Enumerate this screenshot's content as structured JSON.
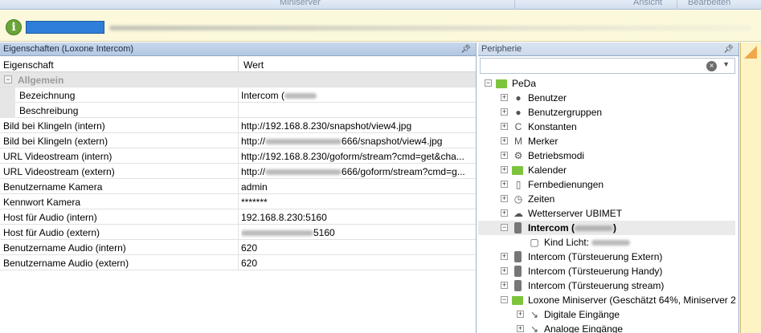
{
  "ribbon": {
    "center_label": "Miniserver",
    "right_labels": [
      "Ansicht",
      "Bearbeiten"
    ]
  },
  "infobar": {
    "icon": "info-icon"
  },
  "properties_panel": {
    "title": "Eigenschaften (Loxone Intercom)",
    "columns": {
      "property": "Eigenschaft",
      "value": "Wert"
    },
    "group_label": "Allgemein",
    "rows": [
      {
        "name": "Bezeichnung",
        "value": "Intercom (",
        "sub": true
      },
      {
        "name": "Beschreibung",
        "value": "",
        "sub": true
      },
      {
        "name": "Bild bei Klingeln (intern)",
        "value": "http://192.168.8.230/snapshot/view4.jpg"
      },
      {
        "name": "Bild bei Klingeln (extern)",
        "value_prefix": "http://",
        "value": "666/snapshot/view4.jpg"
      },
      {
        "name": "URL Videostream (intern)",
        "value": "http://192.168.8.230/goform/stream?cmd=get&cha..."
      },
      {
        "name": "URL Videostream (extern)",
        "value_prefix": "http://",
        "value": "666/goform/stream?cmd=g..."
      },
      {
        "name": "Benutzername Kamera",
        "value": "admin"
      },
      {
        "name": "Kennwort Kamera",
        "value": "*******"
      },
      {
        "name": "Host für Audio (intern)",
        "value": "192.168.8.230:5160"
      },
      {
        "name": "Host für Audio (extern)",
        "value": "5160"
      },
      {
        "name": "Benutzername Audio (intern)",
        "value": "620"
      },
      {
        "name": "Benutzername Audio (extern)",
        "value": "620"
      }
    ]
  },
  "peripherie_panel": {
    "title": "Peripherie",
    "tree": [
      {
        "label": "PeDa",
        "icon": "house-icon",
        "level": 0,
        "expanded": true
      },
      {
        "label": "Benutzer",
        "icon": "user-icon",
        "level": 1
      },
      {
        "label": "Benutzergruppen",
        "icon": "usergroup-icon",
        "level": 1
      },
      {
        "label": "Konstanten",
        "icon": "constant-icon",
        "level": 1
      },
      {
        "label": "Merker",
        "icon": "flag-icon",
        "level": 1
      },
      {
        "label": "Betriebsmodi",
        "icon": "gear-icon",
        "level": 1
      },
      {
        "label": "Kalender",
        "icon": "calendar-icon",
        "level": 1
      },
      {
        "label": "Fernbedienungen",
        "icon": "remote-icon",
        "level": 1
      },
      {
        "label": "Zeiten",
        "icon": "clock-icon",
        "level": 1
      },
      {
        "label": "Wetterserver UBIMET",
        "icon": "weather-icon",
        "level": 1
      },
      {
        "label": "Intercom (",
        "suffix": ")",
        "icon": "intercom-icon",
        "level": 1,
        "selected": true,
        "expanded": true
      },
      {
        "label": "Kind Licht: ",
        "icon": "document-icon",
        "level": 2
      },
      {
        "label": "Intercom (Türsteuerung Extern)",
        "icon": "intercom-icon",
        "level": 1
      },
      {
        "label": "Intercom (Türsteuerung Handy)",
        "icon": "intercom-icon",
        "level": 1
      },
      {
        "label": "Intercom (Türsteuerung stream)",
        "icon": "intercom-icon",
        "level": 1
      },
      {
        "label": "Loxone Miniserver (Geschätzt 64%, Miniserver 2",
        "icon": "miniserver-icon",
        "level": 1,
        "expanded": true
      },
      {
        "label": "Digitale Eingänge",
        "icon": "digital-input-icon",
        "level": 2
      },
      {
        "label": "Analoge Eingänge",
        "icon": "analog-input-icon",
        "level": 2
      }
    ]
  }
}
